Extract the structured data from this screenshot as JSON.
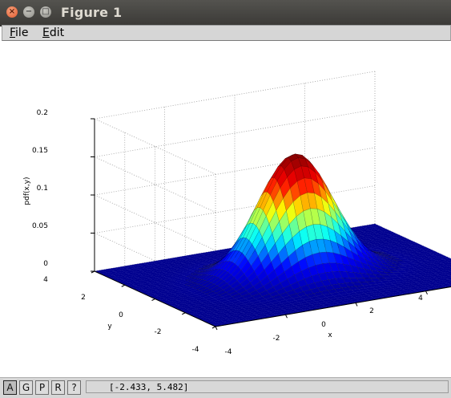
{
  "window": {
    "title": "Figure 1",
    "close_glyph": "×",
    "minimize_glyph": "−",
    "maximize_glyph": "□"
  },
  "menu": {
    "items": [
      {
        "underline": "F",
        "rest": "ile"
      },
      {
        "underline": "E",
        "rest": "dit"
      }
    ]
  },
  "plot": {
    "zlabel": "pdf(x,y)",
    "xlabel": "x",
    "ylabel": "y",
    "z_ticks": [
      "0.2",
      "0.15",
      "0.1",
      "0.05",
      "0"
    ],
    "y_ticks": [
      "4",
      "2",
      "0",
      "-2",
      "-4"
    ],
    "x_ticks": [
      "-4",
      "-2",
      "0",
      "2",
      "4"
    ],
    "colormap": [
      "#00008f",
      "#0000ff",
      "#00ffff",
      "#ffff00",
      "#ff0000",
      "#800000"
    ],
    "grid": true
  },
  "chart_data": {
    "type": "surface",
    "function": "pdf(x,y)",
    "xlabel": "x",
    "ylabel": "y",
    "zlabel": "pdf(x,y)",
    "xlim": [
      -4,
      4
    ],
    "ylim": [
      -4,
      4
    ],
    "zlim": [
      0,
      0.2
    ],
    "peak": {
      "x": 0,
      "y": 0,
      "z": 0.159
    },
    "colormap": "jet"
  },
  "statusbar": {
    "buttons": [
      "A",
      "G",
      "P",
      "R",
      "?"
    ],
    "coordinates": "[-2.433, 5.482]"
  }
}
